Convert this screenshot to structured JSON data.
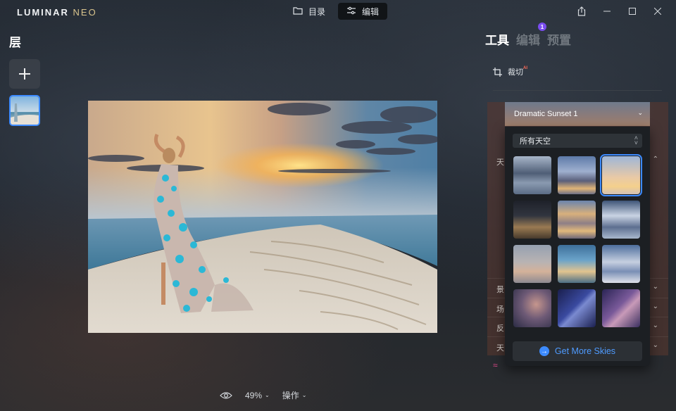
{
  "app": {
    "logo_main": "LUMINAR ",
    "logo_sub": "NEO"
  },
  "top_tabs": [
    {
      "label": "目录",
      "icon": "folder-icon",
      "active": false
    },
    {
      "label": "编辑",
      "icon": "sliders-icon",
      "active": true
    }
  ],
  "window_controls": [
    "share-icon",
    "minimize-icon",
    "maximize-icon",
    "close-icon"
  ],
  "layers": {
    "title": "层"
  },
  "bottom_bar": {
    "zoom": "49%",
    "actions": "操作"
  },
  "panel": {
    "tabs": [
      {
        "label": "工具",
        "active": true
      },
      {
        "label": "编辑",
        "active": false,
        "badge": "1"
      },
      {
        "label": "预置",
        "active": false
      }
    ],
    "crop": {
      "label": "裁切",
      "ai": "AI"
    },
    "sky_select": {
      "value": "Dramatic Sunset 1"
    },
    "sky_filter": {
      "value": "所有天空"
    },
    "get_more": {
      "label": "Get More Skies"
    },
    "rows": [
      {
        "label": "天"
      },
      {
        "label": "景"
      },
      {
        "label": "场"
      },
      {
        "label": "反"
      },
      {
        "label": "天"
      }
    ]
  },
  "colors": {
    "accent": "#3d8bff",
    "badge": "#7a4cf0",
    "ai": "#ff6b57"
  }
}
